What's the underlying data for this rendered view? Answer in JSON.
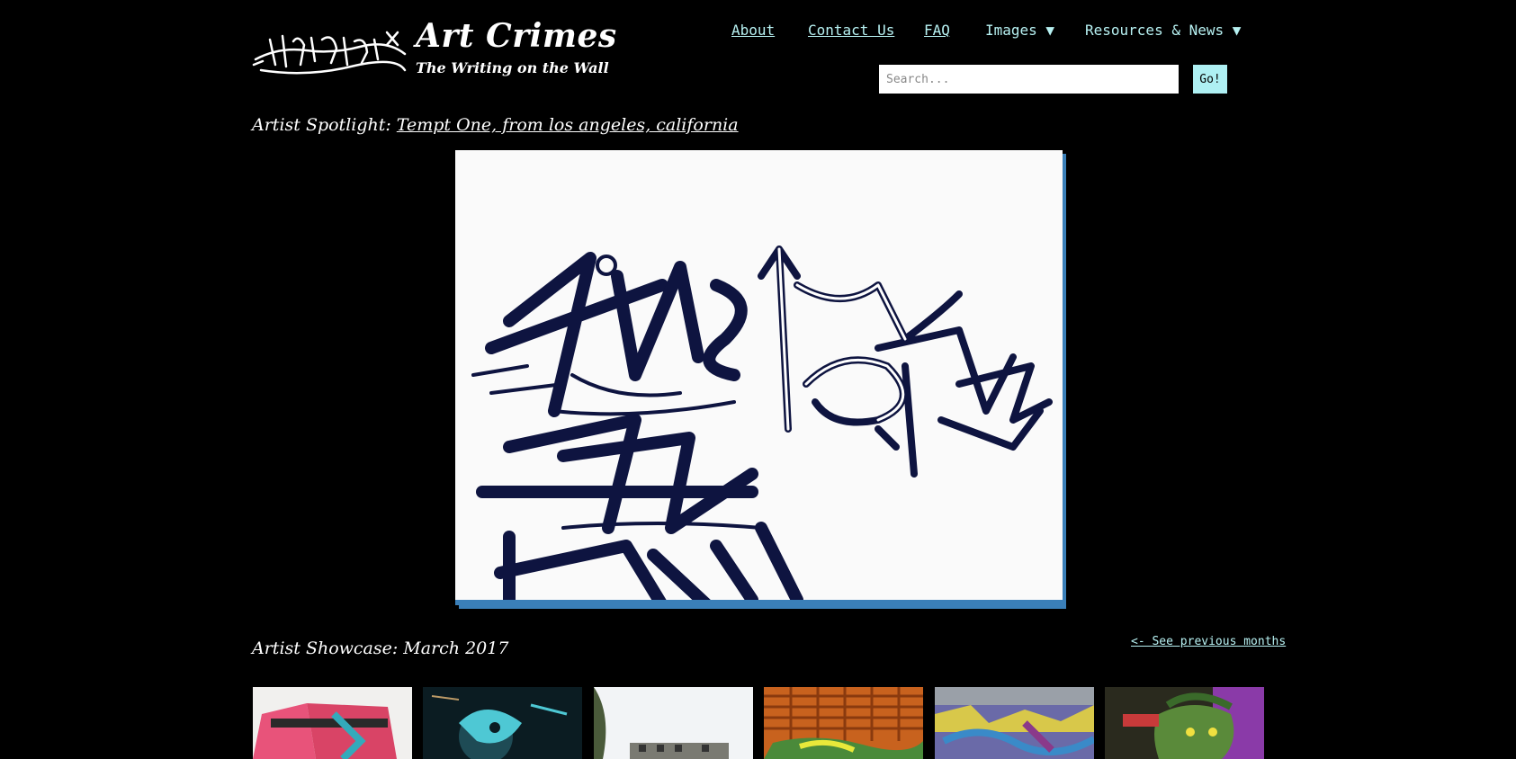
{
  "site": {
    "title": "Art Crimes",
    "tagline": "The Writing on the Wall"
  },
  "nav": {
    "about": "About",
    "contact": "Contact Us",
    "faq": "FAQ",
    "images": "Images ▼",
    "resources": "Resources & News ▼"
  },
  "search": {
    "placeholder": "Search...",
    "value": "",
    "button": "Go!"
  },
  "spotlight": {
    "label": "Artist Spotlight:",
    "link": "Tempt One, from los angeles, california"
  },
  "showcase": {
    "label": "Artist Showcase: March 2017",
    "previous_link": "<- See previous months"
  },
  "colors": {
    "background": "#000000",
    "link": "#b7f1f2",
    "button": "#aef0f3",
    "frame_shadow": "#3a7fb8"
  }
}
